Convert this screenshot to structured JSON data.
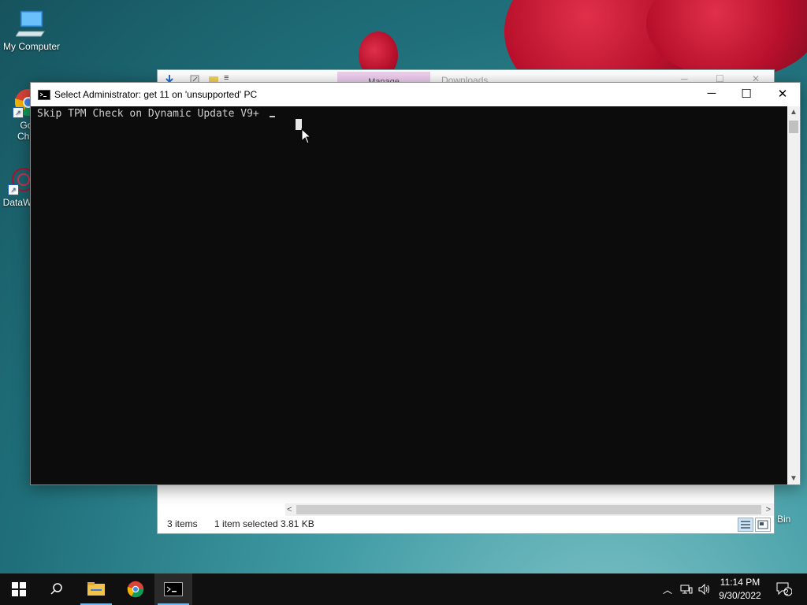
{
  "desktop": {
    "icons": [
      {
        "label": "My Computer"
      },
      {
        "label": "Goo\nChro"
      },
      {
        "label": "DataW"
      },
      {
        "label": "e Bin"
      }
    ]
  },
  "explorer": {
    "ribbon_tab_manage": "Manage",
    "window_title": "Downloads",
    "status_items": "3 items",
    "status_selected": "1 item selected",
    "status_size": "3.81 KB"
  },
  "cmd": {
    "title": "Select Administrator:  get 11 on 'unsupported' PC",
    "console_line": "Skip TPM Check on Dynamic Update V9+ ",
    "minimize": "─",
    "maximize": "☐",
    "close": "✕"
  },
  "taskbar": {
    "time": "11:14 PM",
    "date": "9/30/2022",
    "notification_count": "2"
  },
  "colors": {
    "console_bg": "#0c0c0c",
    "console_fg": "#cccccc",
    "taskbar_bg": "#101010",
    "accent": "#76b9ed"
  }
}
